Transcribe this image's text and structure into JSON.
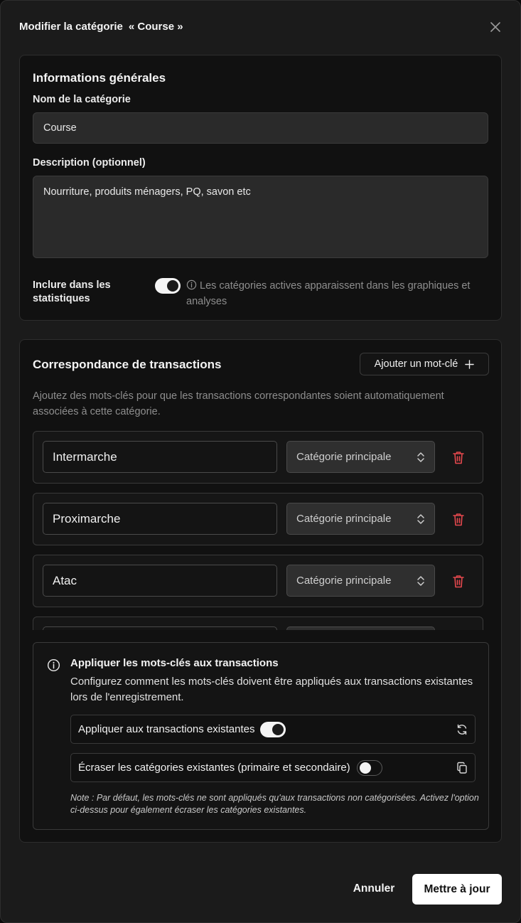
{
  "modal": {
    "title": "Modifier la catégorie",
    "category_name": "« Course »"
  },
  "general": {
    "title": "Informations générales",
    "name_label": "Nom de la catégorie",
    "name_value": "Course",
    "description_label": "Description (optionnel)",
    "description_value": "Nourriture, produits ménagers, PQ, savon etc",
    "include_label": "Inclure dans les statistiques",
    "include_enabled": true,
    "include_hint": "Les catégories actives apparaissent dans les graphiques et analyses"
  },
  "matching": {
    "title": "Correspondance de transactions",
    "add_button_label": "Ajouter un mot-clé",
    "description": "Ajoutez des mots-clés pour que les transactions correspondantes soient automatiquement associées à cette catégorie.",
    "keywords": [
      {
        "value": "Intermarche",
        "category": "Catégorie principale"
      },
      {
        "value": "Proximarche",
        "category": "Catégorie principale"
      },
      {
        "value": "Atac",
        "category": "Catégorie principale"
      },
      {
        "value": "",
        "category": ""
      }
    ]
  },
  "apply": {
    "title": "Appliquer les mots-clés aux transactions",
    "description": "Configurez comment les mots-clés doivent être appliqués aux transactions existantes lors de l'enregistrement.",
    "option_existing_label": "Appliquer aux transactions existantes",
    "option_existing_enabled": true,
    "option_overwrite_label": "Écraser les catégories existantes (primaire et secondaire)",
    "option_overwrite_enabled": false,
    "note": "Note : Par défaut, les mots-clés ne sont appliqués qu'aux transactions non catégorisées. Activez l'option ci-dessus pour également écraser les catégories existantes."
  },
  "footer": {
    "cancel_label": "Annuler",
    "update_label": "Mettre à jour"
  },
  "colors": {
    "background": "#1b1b1b",
    "card": "#111111",
    "danger": "#e5484d",
    "primary_button": "#ffffff"
  },
  "icons": [
    "close-icon",
    "info-icon",
    "plus-icon",
    "chevron-updown-icon",
    "trash-icon",
    "refresh-icon",
    "copy-icon"
  ]
}
